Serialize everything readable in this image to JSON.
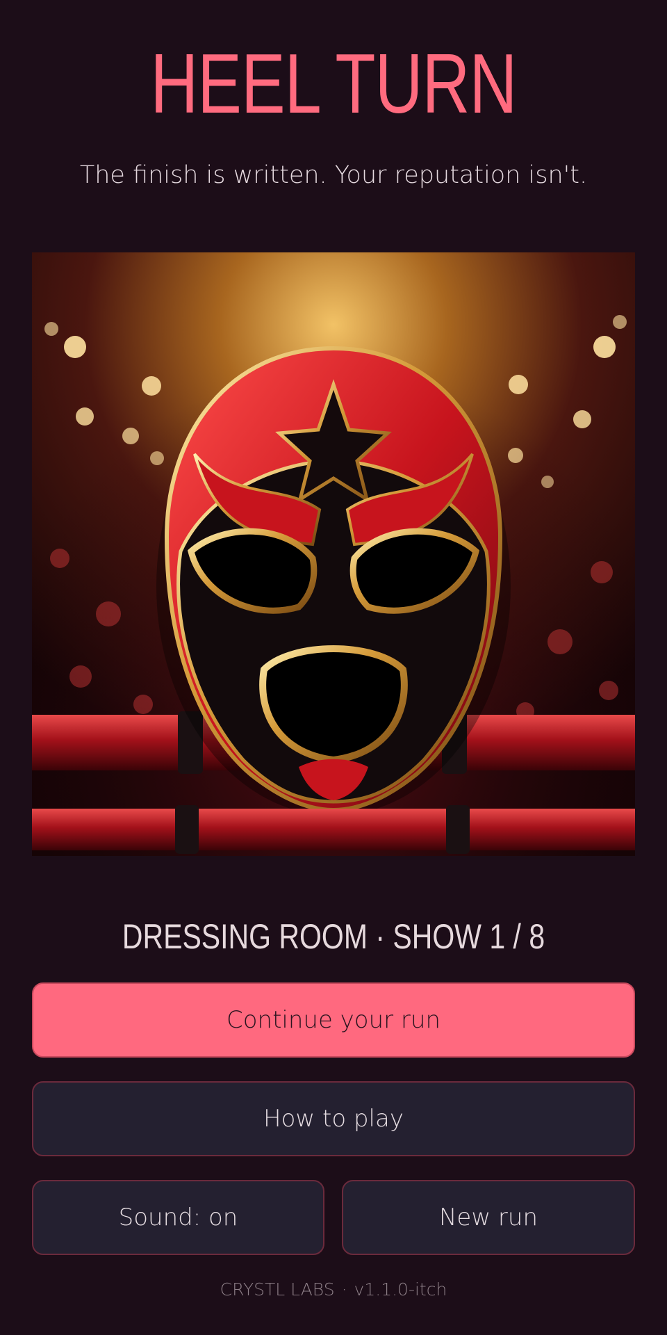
{
  "title": "HEEL TURN",
  "tagline": "The finish is written. Your reputation isn't.",
  "art": {
    "subject": "luchador-mask-icon"
  },
  "status": "DRESSING ROOM · SHOW 1 / 8",
  "buttons": {
    "continue": "Continue your run",
    "how_to_play": "How to play",
    "sound": "Sound: on",
    "new_run": "New run"
  },
  "footer": {
    "studio": "CRYSTL LABS",
    "separator": "·",
    "version": "v1.1.0-itch"
  },
  "colors": {
    "accent": "#ff697f",
    "background": "#1c0d18",
    "secondary_button": "#242030"
  }
}
